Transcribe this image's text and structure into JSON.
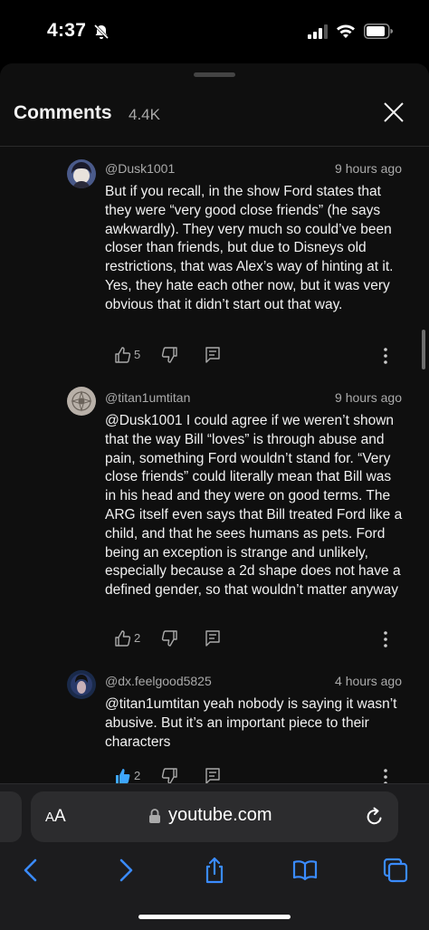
{
  "status_bar": {
    "time": "4:37"
  },
  "header": {
    "title": "Comments",
    "count": "4.4K"
  },
  "comments": [
    {
      "author": "@Dusk1001",
      "time": "9 hours ago",
      "text": "But if you recall, in the show Ford states that they were “very good close friends” (he says awkwardly). They very much so could’ve been closer than friends, but due to Disneys old restrictions, that was Alex’s way of hinting at it. Yes, they hate each other now, but it was very obvious that it didn’t start out that way.",
      "likes": "5",
      "liked": false
    },
    {
      "author": "@titan1umtitan",
      "time": "9 hours ago",
      "text": "@Dusk1001 I could agree if we weren’t shown that the way Bill “loves” is through abuse and pain, something Ford wouldn’t stand for. “Very close friends” could literally mean that Bill was in his head and they were on good terms. The ARG itself even says that Bill treated Ford like a child, and that he sees humans as pets. Ford being an exception is strange and unlikely, especially because a 2d shape does not have a defined gender, so that wouldn’t matter anyway",
      "likes": "2",
      "liked": false
    },
    {
      "author": "@dx.feelgood5825",
      "time": "4 hours ago",
      "text": "@titan1umtitan yeah nobody is saying it wasn’t abusive. But it’s an important piece to their characters",
      "likes": "2",
      "liked": true
    }
  ],
  "browser": {
    "aa_big": "A",
    "aa_small": "A",
    "url": "youtube.com"
  },
  "colors": {
    "like_active": "#3ea6ff",
    "text_secondary": "#aaaaaa",
    "sheet_bg": "#0f0f0f"
  }
}
